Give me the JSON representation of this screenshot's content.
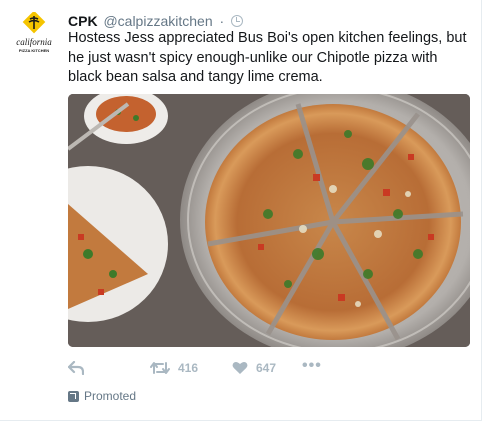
{
  "tweet": {
    "avatar": {
      "brand_top": "california",
      "brand_bottom": "PIZZA KITCHEN",
      "color": "#f5c400"
    },
    "name": "CPK",
    "handle": "@calpizzakitchen",
    "separator": "·",
    "text": "Hostess Jess appreciated Bus Boi's open kitchen feelings, but he just wasn't spicy enough-unlike our Chipotle pizza with black bean salsa and tangy lime crema.",
    "actions": {
      "reply_icon": "reply-icon",
      "retweet_icon": "retweet-icon",
      "retweet_count": "416",
      "like_icon": "heart-icon",
      "like_count": "647",
      "more_icon": "more-icon",
      "more_label": "•••"
    },
    "promoted_label": "Promoted",
    "colors": {
      "text": "#14171a",
      "secondary": "#657786",
      "icon": "#aab8c2"
    }
  }
}
